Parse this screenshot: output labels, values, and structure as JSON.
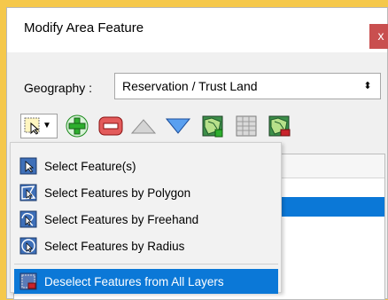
{
  "window": {
    "title": "Modify Area Feature",
    "close_glyph": "x"
  },
  "geography": {
    "label": "Geography :",
    "selected": "Reservation / Trust Land",
    "dropdown_glyph": "⬍"
  },
  "toolbar": {
    "selection_tool_icon": "select-region-icon",
    "dropdown_icon": "chevron-down-icon",
    "buttons": [
      {
        "icon": "add-icon"
      },
      {
        "icon": "remove-icon"
      },
      {
        "icon": "up-arrow-icon"
      },
      {
        "icon": "down-arrow-icon"
      },
      {
        "icon": "map-add-icon"
      },
      {
        "icon": "map-table-icon"
      },
      {
        "icon": "map-remove-icon"
      }
    ]
  },
  "menu": {
    "items": [
      {
        "label": "Select Feature(s)",
        "icon": "select-feature-icon"
      },
      {
        "label": "Select Features by Polygon",
        "icon": "polygon-select-icon"
      },
      {
        "label": "Select Features by Freehand",
        "icon": "freehand-select-icon"
      },
      {
        "label": "Select Features by Radius",
        "icon": "radius-select-icon"
      },
      {
        "label": "Deselect Features from All Layers",
        "icon": "deselect-all-icon",
        "highlighted": true
      }
    ]
  },
  "colors": {
    "background": "#f5c84b",
    "highlight": "#0b78d7",
    "close_button": "#c94f4f",
    "add_green": "#2eae2e",
    "remove_red": "#c8232b"
  }
}
